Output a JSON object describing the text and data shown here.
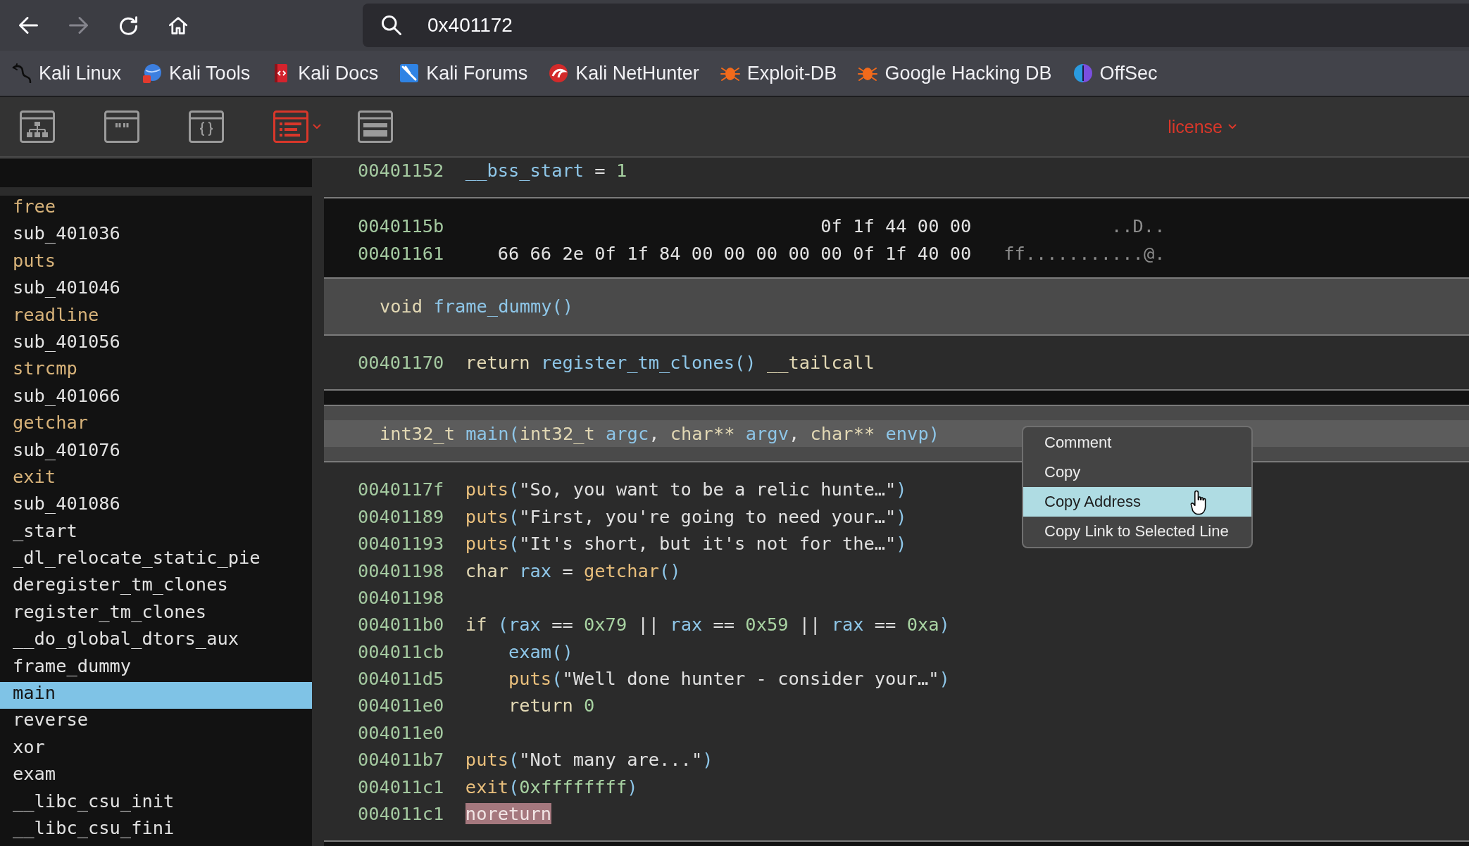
{
  "browser": {
    "nav_buttons": [
      {
        "kind": "back",
        "disabled": false
      },
      {
        "kind": "forward",
        "disabled": true
      },
      {
        "kind": "reload",
        "disabled": false
      },
      {
        "kind": "home",
        "disabled": false
      }
    ],
    "url": "0x401172",
    "bookmarks": [
      {
        "kind": "dragon",
        "label": "Kali Linux"
      },
      {
        "kind": "tools",
        "label": "Kali Tools"
      },
      {
        "kind": "docs",
        "label": "Kali Docs"
      },
      {
        "kind": "forums",
        "label": "Kali Forums"
      },
      {
        "kind": "nethunter",
        "label": "Kali NetHunter"
      },
      {
        "kind": "bug",
        "label": "Exploit-DB"
      },
      {
        "kind": "bug",
        "label": "Google Hacking DB"
      },
      {
        "kind": "offsec",
        "label": "OffSec"
      }
    ]
  },
  "toolbar": {
    "views": [
      {
        "kind": "graph",
        "selected": false
      },
      {
        "kind": "strings",
        "selected": false
      },
      {
        "kind": "code",
        "selected": false
      },
      {
        "kind": "linear",
        "selected": true
      },
      {
        "kind": "hex",
        "selected": false
      }
    ],
    "license": "license"
  },
  "sidebar": {
    "items": [
      {
        "name": "free",
        "kind": "import",
        "selected": false
      },
      {
        "name": "sub_401036",
        "kind": "function",
        "selected": false
      },
      {
        "name": "puts",
        "kind": "import",
        "selected": false
      },
      {
        "name": "sub_401046",
        "kind": "function",
        "selected": false
      },
      {
        "name": "readline",
        "kind": "import",
        "selected": false
      },
      {
        "name": "sub_401056",
        "kind": "function",
        "selected": false
      },
      {
        "name": "strcmp",
        "kind": "import",
        "selected": false
      },
      {
        "name": "sub_401066",
        "kind": "function",
        "selected": false
      },
      {
        "name": "getchar",
        "kind": "import",
        "selected": false
      },
      {
        "name": "sub_401076",
        "kind": "function",
        "selected": false
      },
      {
        "name": "exit",
        "kind": "import",
        "selected": false
      },
      {
        "name": "sub_401086",
        "kind": "function",
        "selected": false
      },
      {
        "name": "_start",
        "kind": "function",
        "selected": false
      },
      {
        "name": "_dl_relocate_static_pie",
        "kind": "function",
        "selected": false
      },
      {
        "name": "deregister_tm_clones",
        "kind": "function",
        "selected": false
      },
      {
        "name": "register_tm_clones",
        "kind": "function",
        "selected": false
      },
      {
        "name": "__do_global_dtors_aux",
        "kind": "function",
        "selected": false
      },
      {
        "name": "frame_dummy",
        "kind": "function",
        "selected": false
      },
      {
        "name": "main",
        "kind": "function",
        "selected": true
      },
      {
        "name": "reverse",
        "kind": "function",
        "selected": false
      },
      {
        "name": "xor",
        "kind": "function",
        "selected": false
      },
      {
        "name": "exam",
        "kind": "function",
        "selected": false
      },
      {
        "name": "__libc_csu_init",
        "kind": "function",
        "selected": false
      },
      {
        "name": "__libc_csu_fini",
        "kind": "function",
        "selected": false
      }
    ]
  },
  "linear_view": {
    "sections": [
      {
        "kind": "block",
        "lines": [
          {
            "address": "00401152",
            "tokens": [
              {
                "kind": "symbol",
                "text": "__bss_start"
              },
              {
                "kind": "plain",
                "text": " = "
              },
              {
                "kind": "number",
                "text": "1"
              }
            ]
          }
        ]
      },
      {
        "kind": "data",
        "rows": [
          {
            "address": "0040115b",
            "bytes": "0f 1f 44 00 00",
            "ascii": "..D.."
          },
          {
            "address": "00401161",
            "bytes": "66 66 2e 0f 1f 84 00 00 00 00 00 0f 1f 40 00",
            "ascii": "ff...........@."
          }
        ]
      },
      {
        "kind": "function",
        "header": {
          "selected": false,
          "signature": [
            {
              "kind": "keyword",
              "text": "void "
            },
            {
              "kind": "symbol",
              "text": "frame_dummy()"
            }
          ]
        },
        "blocks": [
          {
            "lines": [
              {
                "address": "00401170",
                "tokens": [
                  {
                    "kind": "keyword",
                    "text": "return "
                  },
                  {
                    "kind": "symbol",
                    "text": "register_tm_clones()"
                  },
                  {
                    "kind": "keyword",
                    "text": " __tailcall"
                  }
                ]
              }
            ]
          }
        ]
      },
      {
        "kind": "function",
        "header": {
          "selected": true,
          "signature": [
            {
              "kind": "keyword",
              "text": "int32_t "
            },
            {
              "kind": "symbol",
              "text": "main("
            },
            {
              "kind": "keyword",
              "text": "int32_t "
            },
            {
              "kind": "symbol",
              "text": "argc"
            },
            {
              "kind": "plain",
              "text": ", "
            },
            {
              "kind": "keyword",
              "text": "char** "
            },
            {
              "kind": "symbol",
              "text": "argv"
            },
            {
              "kind": "plain",
              "text": ", "
            },
            {
              "kind": "keyword",
              "text": "char** "
            },
            {
              "kind": "symbol",
              "text": "envp)"
            }
          ]
        },
        "blocks": [
          {
            "lines": [
              {
                "address": "0040117f",
                "tokens": [
                  {
                    "kind": "import",
                    "text": "puts"
                  },
                  {
                    "kind": "symbol",
                    "text": "("
                  },
                  {
                    "kind": "string",
                    "text": "\"So, you want to be a relic hunte…\""
                  },
                  {
                    "kind": "symbol",
                    "text": ")"
                  }
                ]
              },
              {
                "address": "00401189",
                "tokens": [
                  {
                    "kind": "import",
                    "text": "puts"
                  },
                  {
                    "kind": "symbol",
                    "text": "("
                  },
                  {
                    "kind": "string",
                    "text": "\"First, you're going to need your…\""
                  },
                  {
                    "kind": "symbol",
                    "text": ")"
                  }
                ]
              },
              {
                "address": "00401193",
                "tokens": [
                  {
                    "kind": "import",
                    "text": "puts"
                  },
                  {
                    "kind": "symbol",
                    "text": "("
                  },
                  {
                    "kind": "string",
                    "text": "\"It's short, but it's not for the…\""
                  },
                  {
                    "kind": "symbol",
                    "text": ")"
                  }
                ]
              },
              {
                "address": "00401198",
                "tokens": [
                  {
                    "kind": "keyword",
                    "text": "char "
                  },
                  {
                    "kind": "symbol",
                    "text": "rax"
                  },
                  {
                    "kind": "plain",
                    "text": " = "
                  },
                  {
                    "kind": "import",
                    "text": "getchar"
                  },
                  {
                    "kind": "symbol",
                    "text": "()"
                  }
                ]
              },
              {
                "address": "00401198"
              },
              {
                "address": "004011b0",
                "tokens": [
                  {
                    "kind": "keyword",
                    "text": "if "
                  },
                  {
                    "kind": "symbol",
                    "text": "(rax"
                  },
                  {
                    "kind": "plain",
                    "text": " == "
                  },
                  {
                    "kind": "number",
                    "text": "0x79"
                  },
                  {
                    "kind": "plain",
                    "text": " || "
                  },
                  {
                    "kind": "symbol",
                    "text": "rax"
                  },
                  {
                    "kind": "plain",
                    "text": " == "
                  },
                  {
                    "kind": "number",
                    "text": "0x59"
                  },
                  {
                    "kind": "plain",
                    "text": " || "
                  },
                  {
                    "kind": "symbol",
                    "text": "rax"
                  },
                  {
                    "kind": "plain",
                    "text": " == "
                  },
                  {
                    "kind": "number",
                    "text": "0xa"
                  },
                  {
                    "kind": "symbol",
                    "text": ")"
                  }
                ],
                "children": [
                  {
                    "address": "004011cb",
                    "tokens": [
                      {
                        "kind": "symbol",
                        "text": "exam()"
                      }
                    ]
                  },
                  {
                    "address": "004011d5",
                    "tokens": [
                      {
                        "kind": "import",
                        "text": "puts"
                      },
                      {
                        "kind": "symbol",
                        "text": "("
                      },
                      {
                        "kind": "string",
                        "text": "\"Well done hunter - consider your…\""
                      },
                      {
                        "kind": "symbol",
                        "text": ")"
                      }
                    ]
                  },
                  {
                    "address": "004011e0",
                    "tokens": [
                      {
                        "kind": "keyword",
                        "text": "return "
                      },
                      {
                        "kind": "number",
                        "text": "0"
                      }
                    ]
                  }
                ]
              },
              {
                "address": "004011e0"
              },
              {
                "address": "004011b7",
                "tokens": [
                  {
                    "kind": "import",
                    "text": "puts"
                  },
                  {
                    "kind": "symbol",
                    "text": "("
                  },
                  {
                    "kind": "string",
                    "text": "\"Not many are...\""
                  },
                  {
                    "kind": "symbol",
                    "text": ")"
                  }
                ]
              },
              {
                "address": "004011c1",
                "tokens": [
                  {
                    "kind": "import",
                    "text": "exit"
                  },
                  {
                    "kind": "symbol",
                    "text": "("
                  },
                  {
                    "kind": "number",
                    "text": "0xffffffff"
                  },
                  {
                    "kind": "symbol",
                    "text": ")"
                  }
                ]
              },
              {
                "address": "004011c1",
                "tokens": [
                  {
                    "kind": "annotation",
                    "text": "noreturn"
                  }
                ]
              }
            ]
          }
        ]
      }
    ]
  },
  "context_menu": {
    "items": [
      {
        "label": "Comment",
        "selected": false
      },
      {
        "label": "Copy",
        "selected": false
      },
      {
        "label": "Copy Address",
        "selected": true
      },
      {
        "label": "Copy Link to Selected Line",
        "selected": false
      }
    ]
  }
}
